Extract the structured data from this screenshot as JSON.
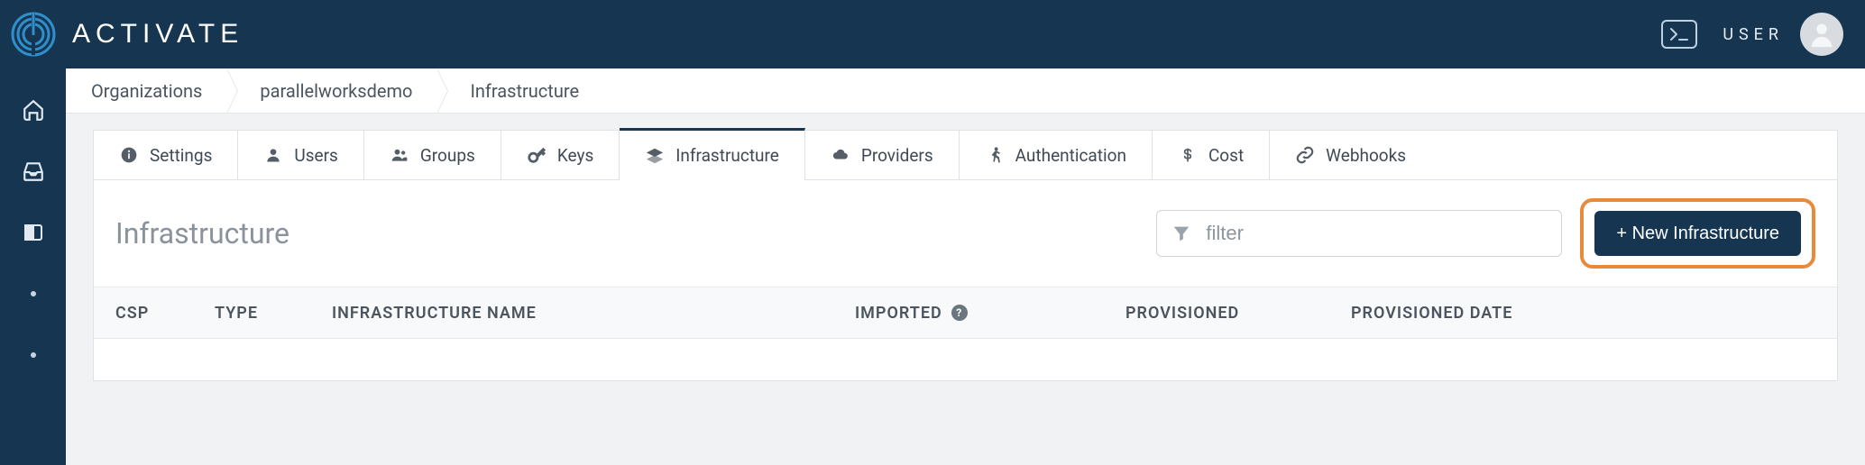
{
  "brand": {
    "word": "ACTIVATE"
  },
  "topbar": {
    "user_label": "USER"
  },
  "breadcrumb": {
    "items": [
      {
        "label": "Organizations"
      },
      {
        "label": "parallelworksdemo"
      },
      {
        "label": "Infrastructure"
      }
    ]
  },
  "tabs": [
    {
      "id": "settings",
      "label": "Settings",
      "icon": "info"
    },
    {
      "id": "users",
      "label": "Users",
      "icon": "user"
    },
    {
      "id": "groups",
      "label": "Groups",
      "icon": "users"
    },
    {
      "id": "keys",
      "label": "Keys",
      "icon": "key"
    },
    {
      "id": "infrastructure",
      "label": "Infrastructure",
      "icon": "layers",
      "active": true
    },
    {
      "id": "providers",
      "label": "Providers",
      "icon": "cloud"
    },
    {
      "id": "authentication",
      "label": "Authentication",
      "icon": "runner"
    },
    {
      "id": "cost",
      "label": "Cost",
      "icon": "dollar"
    },
    {
      "id": "webhooks",
      "label": "Webhooks",
      "icon": "link"
    }
  ],
  "panel": {
    "title": "Infrastructure",
    "filter_placeholder": "filter",
    "new_button": "+ New Infrastructure"
  },
  "table": {
    "columns": {
      "csp": "CSP",
      "type": "TYPE",
      "name": "INFRASTRUCTURE NAME",
      "imported": "IMPORTED",
      "provisioned": "PROVISIONED",
      "provisioned_date": "PROVISIONED DATE"
    },
    "rows": []
  }
}
